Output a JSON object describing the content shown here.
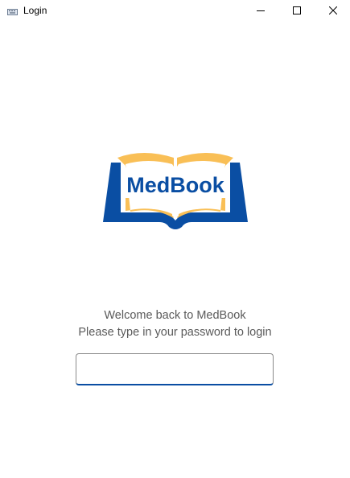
{
  "window": {
    "title": "Login",
    "icon": "keyboard-icon",
    "controls": {
      "minimize": "minimize-icon",
      "maximize": "maximize-icon",
      "close": "close-icon"
    }
  },
  "logo": {
    "text": "MedBook",
    "colors": {
      "blue": "#0a4ea3",
      "gold": "#f9bf56",
      "paper": "#ffffff"
    }
  },
  "welcome": {
    "line1": "Welcome back to MedBook",
    "line2": "Please type in your password to login"
  },
  "password": {
    "value": "",
    "placeholder": ""
  },
  "colors": {
    "accent": "#0a4ea3",
    "text": "#5a5a5a",
    "background": "#ffffff"
  }
}
